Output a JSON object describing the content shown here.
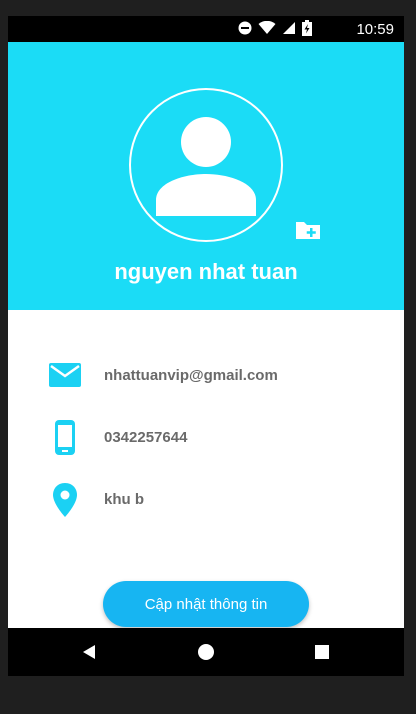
{
  "status_bar": {
    "time": "10:59",
    "icons": [
      "do-not-disturb-icon",
      "wifi-icon",
      "signal-icon",
      "battery-charging-icon"
    ]
  },
  "profile": {
    "name": "nguyen nhat tuan",
    "avatar_icon": "person-icon",
    "folder_add_icon": "folder-add-icon"
  },
  "info": [
    {
      "icon": "email-icon",
      "value": "nhattuanvip@gmail.com"
    },
    {
      "icon": "phone-icon",
      "value": "0342257644"
    },
    {
      "icon": "location-icon",
      "value": "khu b"
    }
  ],
  "update_button": {
    "label": "Cập nhật thông tin"
  },
  "nav_bar": {
    "icons": [
      "back-icon",
      "home-icon",
      "recents-icon"
    ]
  },
  "colors": {
    "header": "#1bdcf6",
    "accent_icon": "#1bd1f3",
    "button": "#17b5f2",
    "text": "#6a6a6a"
  }
}
